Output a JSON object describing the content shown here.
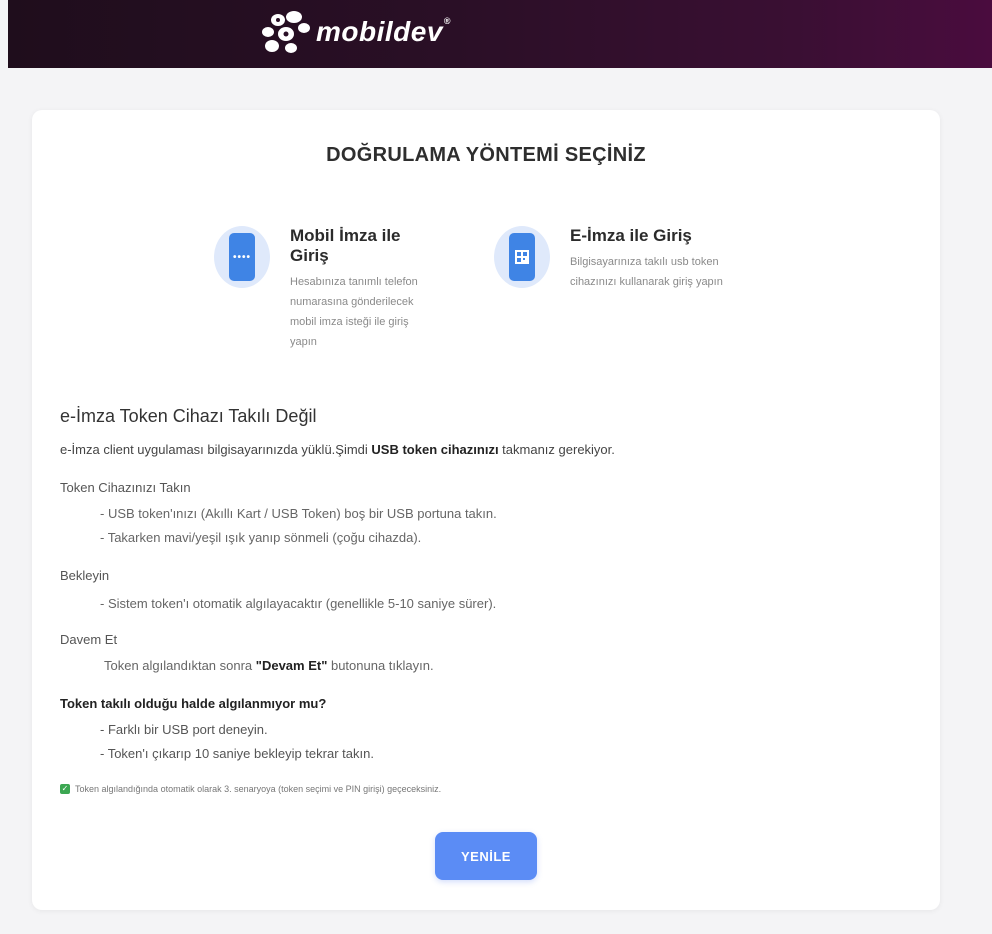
{
  "header": {
    "logo_text": "mobildev",
    "logo_mark": "®",
    "background_colors": [
      "#1f0d1c",
      "#4a0c3e"
    ]
  },
  "card": {
    "title": "DOĞRULAMA YÖNTEMİ SEÇİNİZ",
    "methods": [
      {
        "icon": "mobile-phone-icon",
        "title": "Mobil İmza ile Giriş",
        "description": "Hesabınıza tanımlı telefon numarasına gönderilecek mobil imza isteği ile giriş yapın"
      },
      {
        "icon": "qr-phone-icon",
        "title": "E-İmza ile Giriş",
        "description": "Bilgisayarınıza takılı usb token cihazınızı kullanarak giriş yapın"
      }
    ],
    "status_heading": "e-İmza Token Cihazı Takılı Değil",
    "intro_prefix": "e-İmza client uygulaması bilgisayarınızda yüklü.Şimdi ",
    "intro_bold": "USB token cihazınızı",
    "intro_suffix": " takmanız gerekiyor.",
    "steps": [
      {
        "title": "Token Cihazınızı Takın",
        "bullets": [
          "- USB token'ınızı (Akıllı Kart / USB Token) boş bir USB portuna takın.",
          "- Takarken mavi/yeşil ışık yanıp sönmeli (çoğu cihazda)."
        ]
      },
      {
        "title": "Bekleyin",
        "bullets": [
          "- Sistem token'ı otomatik algılayacaktır (genellikle 5-10 saniye sürer)."
        ]
      },
      {
        "title": "Davem Et",
        "line_prefix": "Token algılandıktan sonra ",
        "line_bold": "\"Devam Et\"",
        "line_suffix": " butonuna tıklayın."
      }
    ],
    "troubleshoot": {
      "title": "Token takılı olduğu halde algılanmıyor mu?",
      "bullets": [
        "- Farklı bir USB port deneyin.",
        "- Token'ı çıkarıp 10 saniye bekleyip tekrar takın."
      ]
    },
    "note": "Token algılandığında otomatik olarak 3. senaryoya (token seçimi ve PIN girişi) geçeceksiniz.",
    "note_icon": "check-icon",
    "refresh_button": "YENİLE",
    "accent_color": "#5b8cf5",
    "check_color": "#3ca752"
  }
}
